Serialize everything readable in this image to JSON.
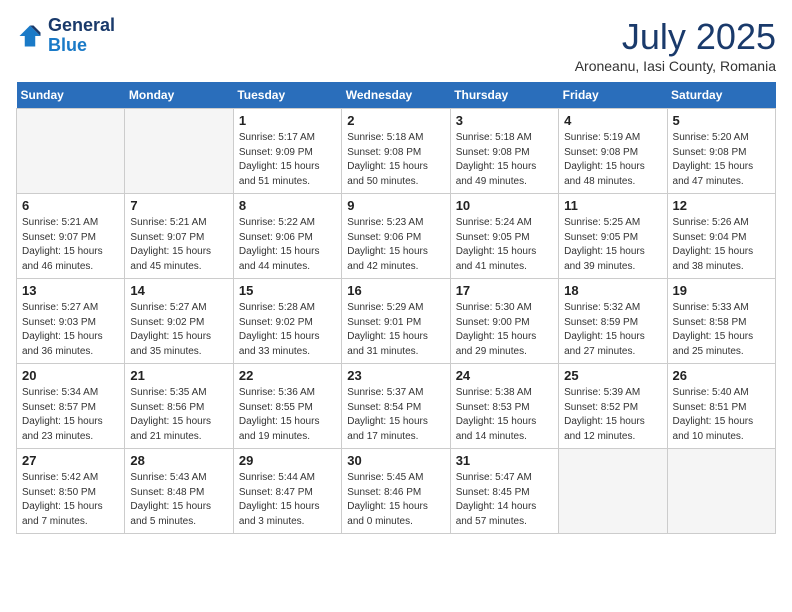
{
  "header": {
    "logo_line1": "General",
    "logo_line2": "Blue",
    "month": "July 2025",
    "location": "Aroneanu, Iasi County, Romania"
  },
  "weekdays": [
    "Sunday",
    "Monday",
    "Tuesday",
    "Wednesday",
    "Thursday",
    "Friday",
    "Saturday"
  ],
  "weeks": [
    [
      {
        "day": "",
        "empty": true
      },
      {
        "day": "",
        "empty": true
      },
      {
        "day": "1",
        "sunrise": "Sunrise: 5:17 AM",
        "sunset": "Sunset: 9:09 PM",
        "daylight": "Daylight: 15 hours and 51 minutes."
      },
      {
        "day": "2",
        "sunrise": "Sunrise: 5:18 AM",
        "sunset": "Sunset: 9:08 PM",
        "daylight": "Daylight: 15 hours and 50 minutes."
      },
      {
        "day": "3",
        "sunrise": "Sunrise: 5:18 AM",
        "sunset": "Sunset: 9:08 PM",
        "daylight": "Daylight: 15 hours and 49 minutes."
      },
      {
        "day": "4",
        "sunrise": "Sunrise: 5:19 AM",
        "sunset": "Sunset: 9:08 PM",
        "daylight": "Daylight: 15 hours and 48 minutes."
      },
      {
        "day": "5",
        "sunrise": "Sunrise: 5:20 AM",
        "sunset": "Sunset: 9:08 PM",
        "daylight": "Daylight: 15 hours and 47 minutes."
      }
    ],
    [
      {
        "day": "6",
        "sunrise": "Sunrise: 5:21 AM",
        "sunset": "Sunset: 9:07 PM",
        "daylight": "Daylight: 15 hours and 46 minutes."
      },
      {
        "day": "7",
        "sunrise": "Sunrise: 5:21 AM",
        "sunset": "Sunset: 9:07 PM",
        "daylight": "Daylight: 15 hours and 45 minutes."
      },
      {
        "day": "8",
        "sunrise": "Sunrise: 5:22 AM",
        "sunset": "Sunset: 9:06 PM",
        "daylight": "Daylight: 15 hours and 44 minutes."
      },
      {
        "day": "9",
        "sunrise": "Sunrise: 5:23 AM",
        "sunset": "Sunset: 9:06 PM",
        "daylight": "Daylight: 15 hours and 42 minutes."
      },
      {
        "day": "10",
        "sunrise": "Sunrise: 5:24 AM",
        "sunset": "Sunset: 9:05 PM",
        "daylight": "Daylight: 15 hours and 41 minutes."
      },
      {
        "day": "11",
        "sunrise": "Sunrise: 5:25 AM",
        "sunset": "Sunset: 9:05 PM",
        "daylight": "Daylight: 15 hours and 39 minutes."
      },
      {
        "day": "12",
        "sunrise": "Sunrise: 5:26 AM",
        "sunset": "Sunset: 9:04 PM",
        "daylight": "Daylight: 15 hours and 38 minutes."
      }
    ],
    [
      {
        "day": "13",
        "sunrise": "Sunrise: 5:27 AM",
        "sunset": "Sunset: 9:03 PM",
        "daylight": "Daylight: 15 hours and 36 minutes."
      },
      {
        "day": "14",
        "sunrise": "Sunrise: 5:27 AM",
        "sunset": "Sunset: 9:02 PM",
        "daylight": "Daylight: 15 hours and 35 minutes."
      },
      {
        "day": "15",
        "sunrise": "Sunrise: 5:28 AM",
        "sunset": "Sunset: 9:02 PM",
        "daylight": "Daylight: 15 hours and 33 minutes."
      },
      {
        "day": "16",
        "sunrise": "Sunrise: 5:29 AM",
        "sunset": "Sunset: 9:01 PM",
        "daylight": "Daylight: 15 hours and 31 minutes."
      },
      {
        "day": "17",
        "sunrise": "Sunrise: 5:30 AM",
        "sunset": "Sunset: 9:00 PM",
        "daylight": "Daylight: 15 hours and 29 minutes."
      },
      {
        "day": "18",
        "sunrise": "Sunrise: 5:32 AM",
        "sunset": "Sunset: 8:59 PM",
        "daylight": "Daylight: 15 hours and 27 minutes."
      },
      {
        "day": "19",
        "sunrise": "Sunrise: 5:33 AM",
        "sunset": "Sunset: 8:58 PM",
        "daylight": "Daylight: 15 hours and 25 minutes."
      }
    ],
    [
      {
        "day": "20",
        "sunrise": "Sunrise: 5:34 AM",
        "sunset": "Sunset: 8:57 PM",
        "daylight": "Daylight: 15 hours and 23 minutes."
      },
      {
        "day": "21",
        "sunrise": "Sunrise: 5:35 AM",
        "sunset": "Sunset: 8:56 PM",
        "daylight": "Daylight: 15 hours and 21 minutes."
      },
      {
        "day": "22",
        "sunrise": "Sunrise: 5:36 AM",
        "sunset": "Sunset: 8:55 PM",
        "daylight": "Daylight: 15 hours and 19 minutes."
      },
      {
        "day": "23",
        "sunrise": "Sunrise: 5:37 AM",
        "sunset": "Sunset: 8:54 PM",
        "daylight": "Daylight: 15 hours and 17 minutes."
      },
      {
        "day": "24",
        "sunrise": "Sunrise: 5:38 AM",
        "sunset": "Sunset: 8:53 PM",
        "daylight": "Daylight: 15 hours and 14 minutes."
      },
      {
        "day": "25",
        "sunrise": "Sunrise: 5:39 AM",
        "sunset": "Sunset: 8:52 PM",
        "daylight": "Daylight: 15 hours and 12 minutes."
      },
      {
        "day": "26",
        "sunrise": "Sunrise: 5:40 AM",
        "sunset": "Sunset: 8:51 PM",
        "daylight": "Daylight: 15 hours and 10 minutes."
      }
    ],
    [
      {
        "day": "27",
        "sunrise": "Sunrise: 5:42 AM",
        "sunset": "Sunset: 8:50 PM",
        "daylight": "Daylight: 15 hours and 7 minutes."
      },
      {
        "day": "28",
        "sunrise": "Sunrise: 5:43 AM",
        "sunset": "Sunset: 8:48 PM",
        "daylight": "Daylight: 15 hours and 5 minutes."
      },
      {
        "day": "29",
        "sunrise": "Sunrise: 5:44 AM",
        "sunset": "Sunset: 8:47 PM",
        "daylight": "Daylight: 15 hours and 3 minutes."
      },
      {
        "day": "30",
        "sunrise": "Sunrise: 5:45 AM",
        "sunset": "Sunset: 8:46 PM",
        "daylight": "Daylight: 15 hours and 0 minutes."
      },
      {
        "day": "31",
        "sunrise": "Sunrise: 5:47 AM",
        "sunset": "Sunset: 8:45 PM",
        "daylight": "Daylight: 14 hours and 57 minutes."
      },
      {
        "day": "",
        "empty": true
      },
      {
        "day": "",
        "empty": true
      }
    ]
  ]
}
